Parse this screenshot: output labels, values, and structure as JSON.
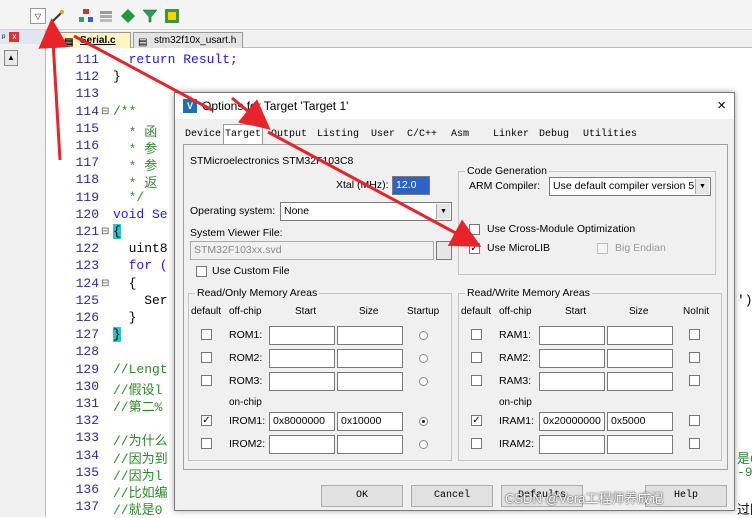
{
  "toolbar": {
    "icons": [
      "dropdown-icon",
      "magic-wand-icon",
      "tree-icon",
      "layers-icon",
      "diamond-icon",
      "funnel-icon",
      "grid-icon"
    ]
  },
  "left_pane": {
    "pin": "ᵖ",
    "close": "x"
  },
  "tabs": [
    {
      "label": "Serial.c",
      "active": true
    },
    {
      "label": "stm32f10x_usart.h",
      "active": false
    }
  ],
  "editor": {
    "lines": [
      {
        "n": "111",
        "fold": "",
        "code": "  return Result;"
      },
      {
        "n": "112",
        "fold": "",
        "code": "}"
      },
      {
        "n": "113",
        "fold": "",
        "code": ""
      },
      {
        "n": "114",
        "fold": "⊟",
        "code": "/**"
      },
      {
        "n": "115",
        "fold": "",
        "code": "  * 函"
      },
      {
        "n": "116",
        "fold": "",
        "code": "  * 参"
      },
      {
        "n": "117",
        "fold": "",
        "code": "  * 参"
      },
      {
        "n": "118",
        "fold": "",
        "code": "  * 返"
      },
      {
        "n": "119",
        "fold": "",
        "code": "  */"
      },
      {
        "n": "120",
        "fold": "",
        "code": "void Se"
      },
      {
        "n": "121",
        "fold": "⊟",
        "code": "{"
      },
      {
        "n": "122",
        "fold": "",
        "code": "  uint8"
      },
      {
        "n": "123",
        "fold": "",
        "code": "  for ("
      },
      {
        "n": "124",
        "fold": "⊟",
        "code": "  {"
      },
      {
        "n": "125",
        "fold": "",
        "code": "    Ser"
      },
      {
        "n": "126",
        "fold": "",
        "code": "  }"
      },
      {
        "n": "127",
        "fold": "",
        "code": "}"
      },
      {
        "n": "128",
        "fold": "",
        "code": ""
      },
      {
        "n": "129",
        "fold": "",
        "code": "//Lengt"
      },
      {
        "n": "130",
        "fold": "",
        "code": "//假设l"
      },
      {
        "n": "131",
        "fold": "",
        "code": "//第二%"
      },
      {
        "n": "132",
        "fold": "",
        "code": ""
      },
      {
        "n": "133",
        "fold": "",
        "code": "//为什么"
      },
      {
        "n": "134",
        "fold": "",
        "code": "//因为到"
      },
      {
        "n": "135",
        "fold": "",
        "code": "//因为l"
      },
      {
        "n": "136",
        "fold": "",
        "code": "//比如编"
      },
      {
        "n": "137",
        "fold": "",
        "code": "//就是0"
      }
    ],
    "right_fragments": [
      {
        "row": 125,
        "text": "')"
      },
      {
        "row": 134,
        "text": "是0"
      },
      {
        "row": 135,
        "text": "-9"
      },
      {
        "row": 137,
        "text": "过同"
      }
    ]
  },
  "dialog": {
    "title": "Options for Target 'Target 1'",
    "close": "×",
    "tabs": [
      "Device",
      "Target",
      "Output",
      "Listing",
      "User",
      "C/C++",
      "Asm",
      "Linker",
      "Debug",
      "Utilities"
    ],
    "active_tab": "Target",
    "device_name": "STMicroelectronics STM32F103C8",
    "xtal_label": "Xtal (MHz):",
    "xtal_value": "12.0",
    "os_label": "Operating system:",
    "os_value": "None",
    "svd_label": "System Viewer File:",
    "svd_value": "STM32F103xx.svd",
    "use_custom_file": "Use Custom File",
    "code_gen": {
      "title": "Code Generation",
      "arm_compiler_label": "ARM Compiler:",
      "arm_compiler_value": "Use default compiler version 5",
      "cross_module": "Use Cross-Module Optimization",
      "microlib": "Use MicroLIB",
      "big_endian": "Big Endian"
    },
    "rom": {
      "title": "Read/Only Memory Areas",
      "headers": {
        "default": "default",
        "offchip": "off-chip",
        "start": "Start",
        "size": "Size",
        "startup": "Startup"
      },
      "onchip_label": "on-chip",
      "rows": [
        {
          "name": "ROM1:",
          "start": "",
          "size": "",
          "default": false,
          "startup": false
        },
        {
          "name": "ROM2:",
          "start": "",
          "size": "",
          "default": false,
          "startup": false
        },
        {
          "name": "ROM3:",
          "start": "",
          "size": "",
          "default": false,
          "startup": false
        },
        {
          "name": "IROM1:",
          "start": "0x8000000",
          "size": "0x10000",
          "default": true,
          "startup": true
        },
        {
          "name": "IROM2:",
          "start": "",
          "size": "",
          "default": false,
          "startup": false
        }
      ]
    },
    "ram": {
      "title": "Read/Write Memory Areas",
      "headers": {
        "default": "default",
        "offchip": "off-chip",
        "start": "Start",
        "size": "Size",
        "noinit": "NoInit"
      },
      "onchip_label": "on-chip",
      "rows": [
        {
          "name": "RAM1:",
          "start": "",
          "size": "",
          "default": false
        },
        {
          "name": "RAM2:",
          "start": "",
          "size": "",
          "default": false
        },
        {
          "name": "RAM3:",
          "start": "",
          "size": "",
          "default": false
        },
        {
          "name": "IRAM1:",
          "start": "0x20000000",
          "size": "0x5000",
          "default": true
        },
        {
          "name": "IRAM2:",
          "start": "",
          "size": "",
          "default": false
        }
      ]
    },
    "buttons": {
      "ok": "OK",
      "cancel": "Cancel",
      "defaults": "Defaults",
      "help": "Help"
    }
  },
  "watermark": "CSDN @Vera工程师养成记",
  "colors": {
    "annotation_arrow": "#e8232a",
    "keyword": "#1a1aff",
    "comment": "#2d8a2d",
    "line_number": "#2a2aa0"
  }
}
